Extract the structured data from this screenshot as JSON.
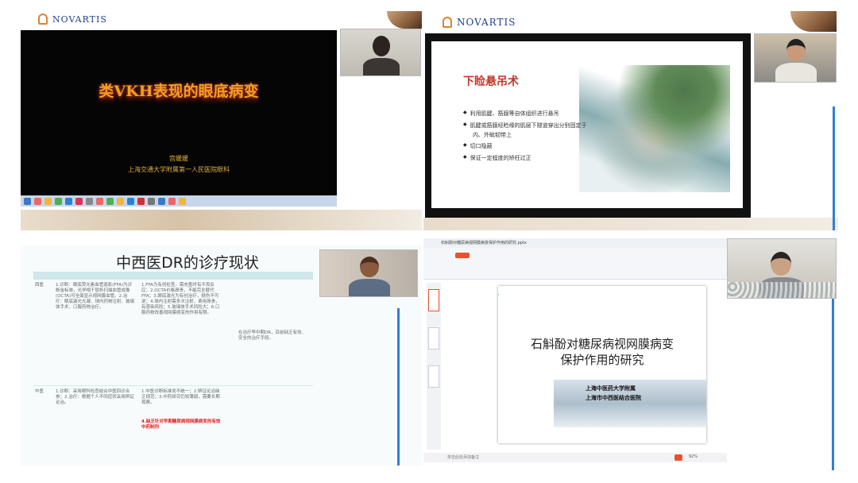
{
  "brand": "NOVARTIS",
  "panel1": {
    "slide_title": "类VKH表现的眼底病变",
    "speaker": "宫媛媛",
    "affiliation": "上海交通大学附属第一人民医院眼科"
  },
  "panel2": {
    "slide_title": "下睑悬吊术",
    "bullets": [
      "利用肌腱、筋膜等自体组织进行悬吊",
      "肌腱或筋膜经睑缘的肌层下隧道穿出分别固定于",
      "内、外眦韧带上",
      "切口隐蔽",
      "保证一定程度的矫枉过正"
    ]
  },
  "panel3": {
    "slide_title": "中西医DR的诊疗现状",
    "rows": [
      {
        "label": "西医",
        "col1": "1.诊断：眼底荧光素血管造影(FFA)为诊断金标准，光学相干层析扫描血管成像(OCTA)可全面显示视网膜血管。2.治疗：眼底激光光凝、球内药物注射、玻璃体手术、口服药物治疗。",
        "col2": "1.FFA为有创检查，需充盈时有不良反应；2.OCTA价格昂贵，不能完全替代FFA；3.眼底激光为有创治疗，损伤不可逆；4.球内注射需多次注射，费用昂贵，有感染风险；5.玻璃体手术风险大；6.口服药物改善视网膜病变的作用有限。",
        "col3": "在治疗早中期DR，目前缺乏有效、安全的治疗手段。",
        "highlight": ""
      },
      {
        "label": "中医",
        "col1": "1.诊断：采用眼科检查结合中医四诊合参；2.治疗：根据个人不同症状采用辨证论治。",
        "col2": "1.中医诊断标准尚不统一；2.辨证论治缺乏规范；3.中药研究仍较薄弱，需要长期观察。",
        "col3": "",
        "highlight": "4.缺乏针对早期糖尿病视网膜病变的有效中药制剂"
      }
    ]
  },
  "panel4": {
    "app_tab": "石斛酚对糖尿病视网膜病变保护作用的研究.pptx",
    "slide_title_line1": "石斛酚对糖尿病视网膜病变",
    "slide_title_line2": "保护作用的研究",
    "affiliation_line1": "上海中医药大学附属",
    "affiliation_line2": "上海市中西医结合医院",
    "status_bar": "单击此处添加备注",
    "zoom": "92%"
  },
  "colors": {
    "accent_blue": "#2f7fd6",
    "brand_blue": "#1f3f8a",
    "slide_red": "#c0392b",
    "table_teal": "#cfe6ea"
  }
}
